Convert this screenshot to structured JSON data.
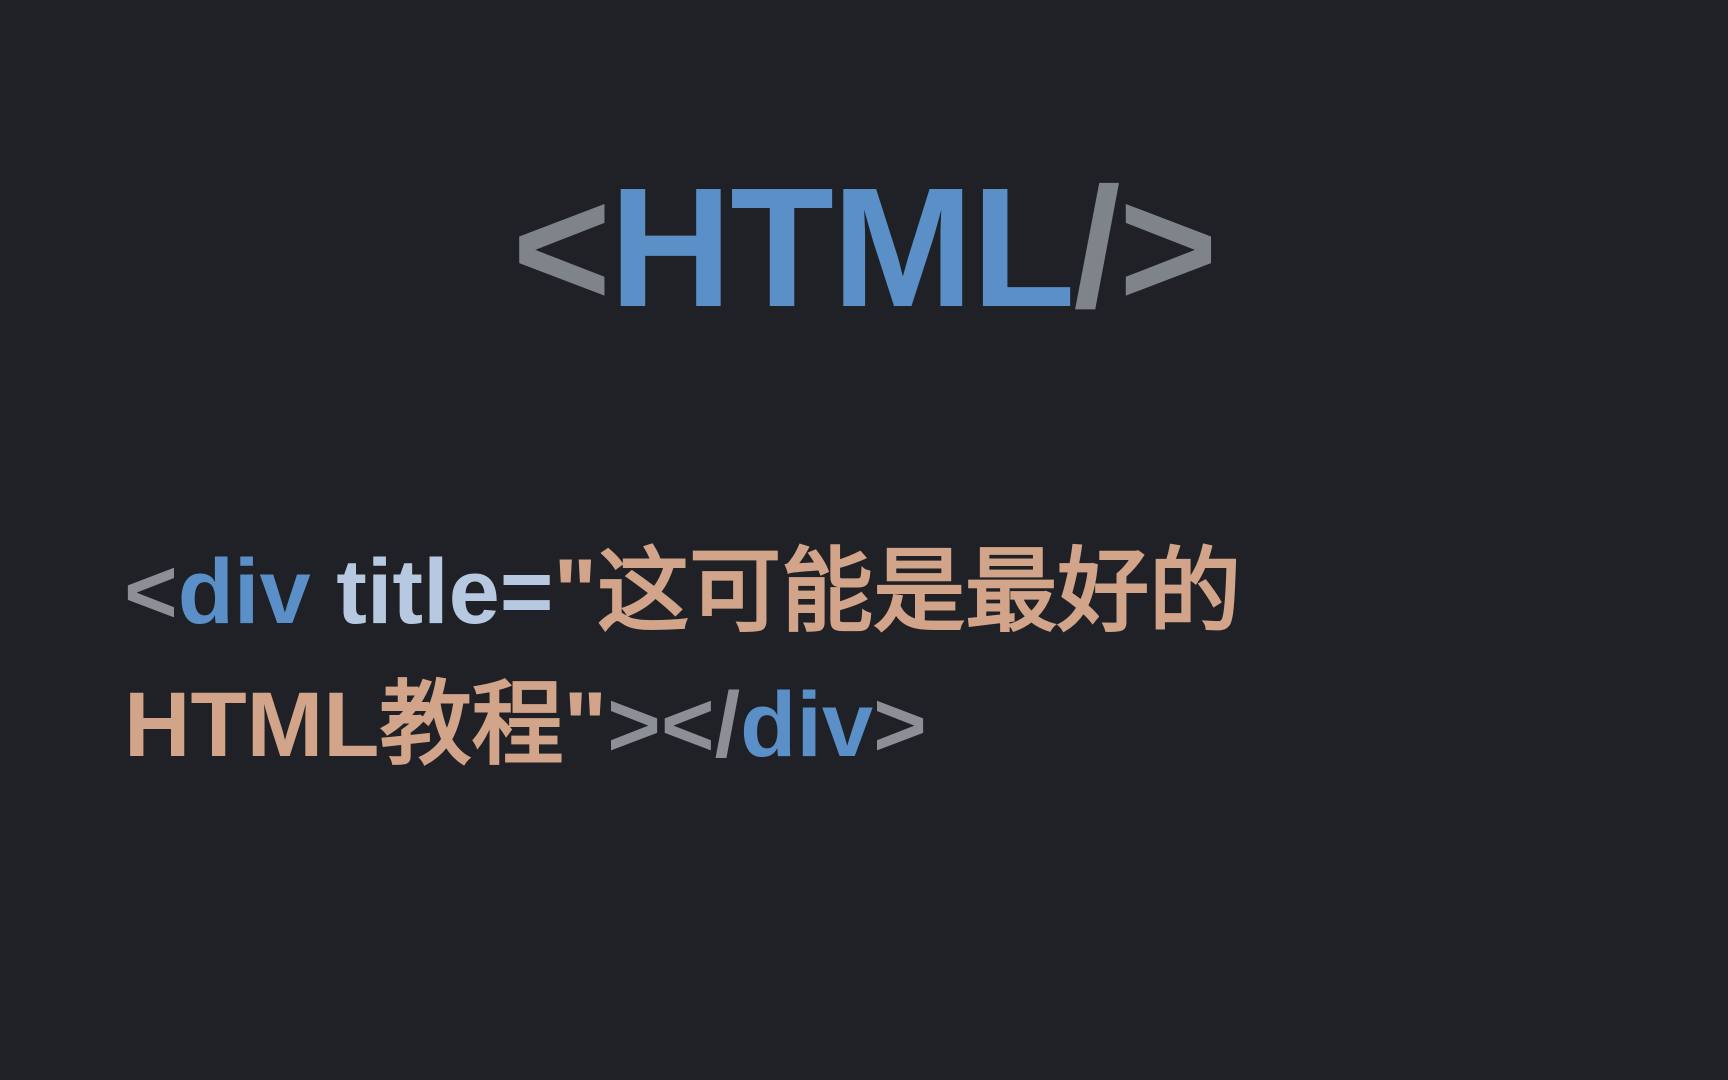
{
  "header": {
    "open_bracket": "<",
    "tag": "HTML",
    "slash": "/",
    "close_bracket": ">"
  },
  "code": {
    "lt1": "<",
    "div1": "div",
    "space": " ",
    "attr": "title=",
    "quote_open": "\"",
    "string_part1": "这可能是最好的",
    "string_part2": "HTML教程",
    "quote_close": "\"",
    "gt1": ">",
    "lt2": "<",
    "slash2": "/",
    "div2": "div",
    "gt2": ">"
  }
}
